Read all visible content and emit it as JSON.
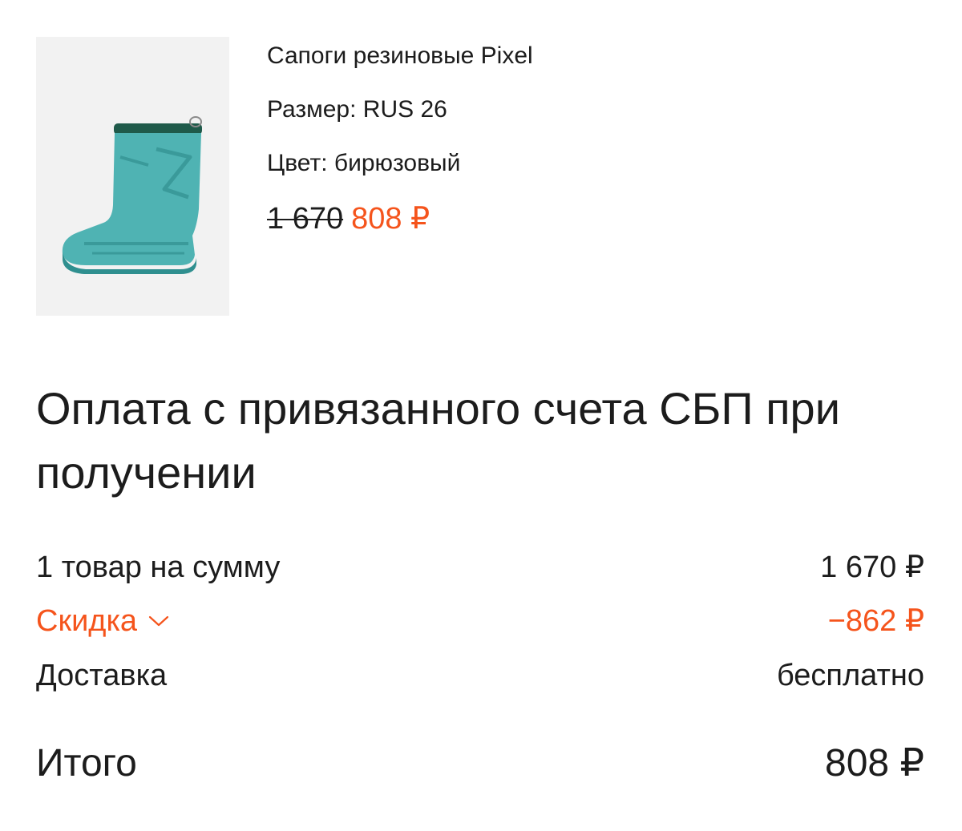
{
  "product": {
    "image_icon": "boot-image",
    "name": "Сапоги резиновые Pixel",
    "size": "Размер: RUS 26",
    "color": "Цвет: бирюзовый",
    "old_price": "1 670",
    "new_price": "808 ₽"
  },
  "payment": {
    "title": "Оплата с привязанного счета СБП при получении"
  },
  "summary": {
    "items_label": "1 товар на сумму",
    "items_value": "1 670 ₽",
    "discount_label": "Скидка",
    "discount_icon": "chevron-down-icon",
    "discount_value": "−862 ₽",
    "delivery_label": "Доставка",
    "delivery_value": "бесплатно",
    "total_label": "Итого",
    "total_value": "808 ₽"
  },
  "colors": {
    "accent": "#f5541c",
    "text": "#1c1c1c",
    "boot": "#4fb3b3",
    "boot_cuff": "#1f5a4a"
  }
}
